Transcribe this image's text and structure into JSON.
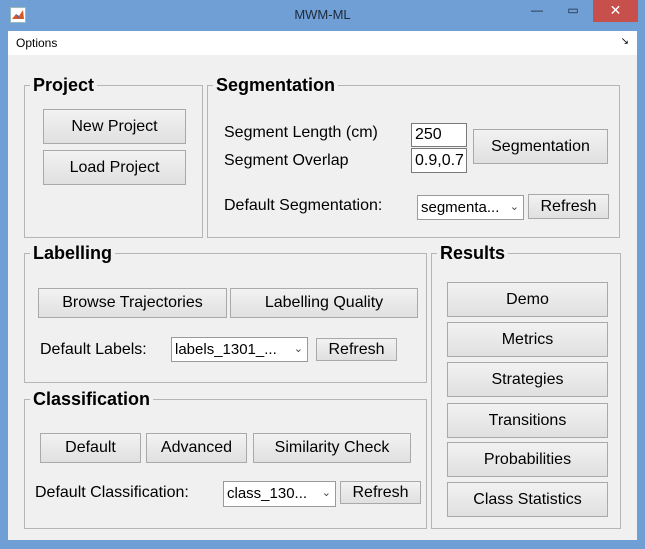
{
  "window": {
    "title": "MWM-ML",
    "minimize": "—",
    "maximize": "▭",
    "close": "✕"
  },
  "menu": {
    "options": "Options",
    "arrow": "↘"
  },
  "project": {
    "title": "Project",
    "new_project": "New Project",
    "load_project": "Load Project"
  },
  "segmentation": {
    "title": "Segmentation",
    "segment_length_label": "Segment Length (cm)",
    "segment_length_value": "250",
    "segment_overlap_label": "Segment Overlap",
    "segment_overlap_value": "0.9,0.7",
    "segmentation_button": "Segmentation",
    "default_label": "Default Segmentation:",
    "default_value": "segmenta...",
    "refresh": "Refresh"
  },
  "labelling": {
    "title": "Labelling",
    "browse": "Browse Trajectories",
    "quality": "Labelling Quality",
    "default_label": "Default Labels:",
    "default_value": "labels_1301_...",
    "refresh": "Refresh"
  },
  "classification": {
    "title": "Classification",
    "default_btn": "Default",
    "advanced": "Advanced",
    "similarity": "Similarity Check",
    "default_label": "Default Classification:",
    "default_value": "class_130...",
    "refresh": "Refresh"
  },
  "results": {
    "title": "Results",
    "buttons": [
      "Demo",
      "Metrics",
      "Strategies",
      "Transitions",
      "Probabilities",
      "Class Statistics"
    ]
  }
}
